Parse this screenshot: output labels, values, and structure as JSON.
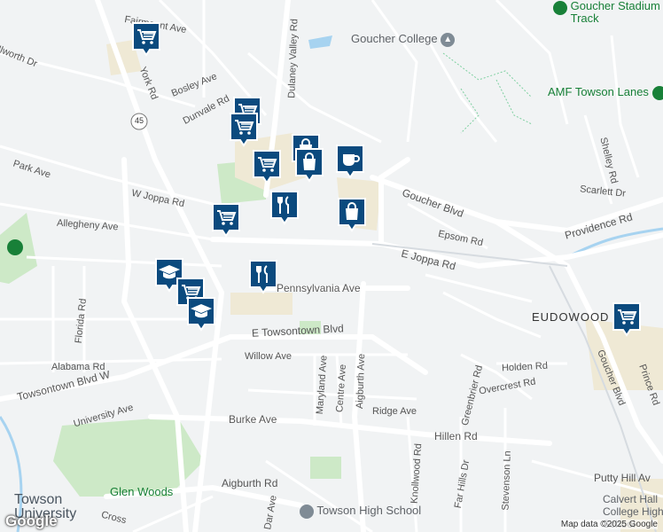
{
  "map": {
    "attribution": "Map data ©2025 Google",
    "logo_text": "Google",
    "area_label": "EUDOWOOD"
  },
  "pois": [
    {
      "label": "Goucher College",
      "icon": "graduation-cap-icon",
      "style": "poi"
    },
    {
      "label": "Goucher Stadium and Track",
      "icon": "stadium-icon",
      "style": "green"
    },
    {
      "label": "AMF Towson Lanes",
      "icon": "bowling-icon",
      "style": "green"
    },
    {
      "label": "Towson High School",
      "icon": "school-icon",
      "style": "poi"
    },
    {
      "label": "Glen Woods",
      "icon": "park-icon",
      "style": "green"
    },
    {
      "label": "Towson University",
      "icon": "university-icon",
      "style": "poi"
    },
    {
      "label": "Calvert Hall College High School",
      "icon": "school-icon",
      "style": "poi"
    }
  ],
  "roads": [
    "Fairmount Ave",
    "York Rd",
    "Bosley Ave",
    "Dunvale Rd",
    "Dulaney Valley Rd",
    "Park Ave",
    "W Joppa Rd",
    "Allegheny Ave",
    "Goucher Blvd",
    "Epsom Rd",
    "Providence Rd",
    "Scarlett Dr",
    "Shelley Rd",
    "E Joppa Rd",
    "Pennsylvania Ave",
    "E Towsontown Blvd",
    "Towsontown Blvd W",
    "Alabama Rd",
    "Willow Ave",
    "Maryland Ave",
    "Centre Ave",
    "Aigburth Ave",
    "Ridge Ave",
    "Holden Rd",
    "Overcrest Rd",
    "Greenbrier Rd",
    "Hillen Rd",
    "Burke Ave",
    "University Ave",
    "Aigburth Rd",
    "Knollwood Rd",
    "Far Hills Dr",
    "Stevenson Ln",
    "Florida Rd",
    "Putty Hill Av",
    "Prince Rd",
    "Cross",
    "Dar Ave",
    "Ilworth Dr"
  ],
  "route_shield": "45",
  "markers": [
    {
      "type": "shopping-cart"
    },
    {
      "type": "shopping-cart"
    },
    {
      "type": "shopping-cart"
    },
    {
      "type": "shopping-cart"
    },
    {
      "type": "shopping-bag"
    },
    {
      "type": "coffee-cup"
    },
    {
      "type": "shopping-bag"
    },
    {
      "type": "shopping-bag"
    },
    {
      "type": "restaurant"
    },
    {
      "type": "shopping-cart"
    },
    {
      "type": "graduation-cap"
    },
    {
      "type": "shopping-cart"
    },
    {
      "type": "restaurant"
    },
    {
      "type": "graduation-cap"
    },
    {
      "type": "shopping-cart"
    }
  ],
  "colors": {
    "marker": "#0b4a7e",
    "marker_border": "#ffffff",
    "park": "#cde9c7",
    "campus": "#efe9d5",
    "water": "#a7d3f0",
    "road": "#ffffff",
    "highway": "#d6dbe0"
  }
}
